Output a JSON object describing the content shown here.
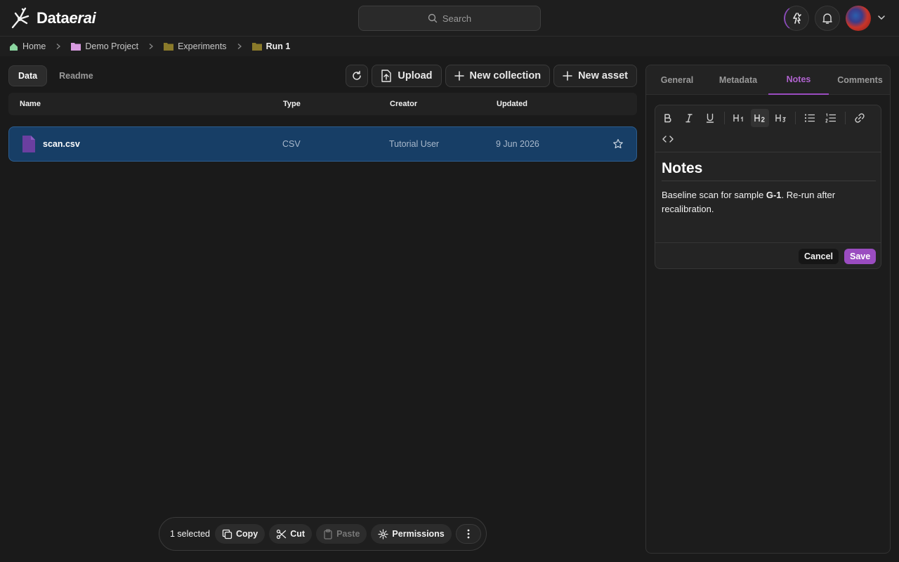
{
  "app": {
    "logo_text_regular": "Data",
    "logo_text_italic": "erai"
  },
  "header": {
    "search_placeholder": "Search"
  },
  "breadcrumb": [
    {
      "label": "Home",
      "icon": "home-icon",
      "color": "#8bd6a0"
    },
    {
      "label": "Demo Project",
      "icon": "folder-icon",
      "color": "#d89be0"
    },
    {
      "label": "Experiments",
      "icon": "folder-icon",
      "color": "#8a7a2a"
    },
    {
      "label": "Run 1",
      "icon": "folder-icon",
      "color": "#8a7a2a"
    }
  ],
  "left_tabs": [
    {
      "label": "Data",
      "active": true
    },
    {
      "label": "Readme",
      "active": false
    }
  ],
  "toolbar": {
    "refresh_icon": "refresh-icon",
    "upload_label": "Upload",
    "new_collection_label": "New collection",
    "new_asset_label": "New asset"
  },
  "table": {
    "columns": [
      "Name",
      "Type",
      "Creator",
      "Updated"
    ],
    "rows": [
      {
        "name": "scan.csv",
        "type": "CSV",
        "creator": "Tutorial User",
        "updated": "9 Jun 2026",
        "selected": true,
        "starred": false
      }
    ]
  },
  "selection_bar": {
    "count_label": "1 selected",
    "copy_label": "Copy",
    "cut_label": "Cut",
    "paste_label": "Paste",
    "permissions_label": "Permissions"
  },
  "right_panel": {
    "tabs": [
      {
        "label": "General",
        "active": false
      },
      {
        "label": "Metadata",
        "active": false
      },
      {
        "label": "Notes",
        "active": true
      },
      {
        "label": "Comments",
        "active": false
      }
    ],
    "editor": {
      "tools": [
        "bold-icon",
        "italic-icon",
        "underline-icon",
        "h1-icon",
        "h2-icon",
        "h3-icon",
        "bullet-list-icon",
        "numbered-list-icon",
        "link-icon",
        "code-icon"
      ],
      "active_tool": "h2-icon",
      "heading": "Notes",
      "body_before": "Baseline scan for sample ",
      "body_bold": "G-1",
      "body_after": ". Re-run after recalibration.",
      "cancel_label": "Cancel",
      "save_label": "Save"
    }
  },
  "colors": {
    "accent": "#9a4cc0",
    "selected_row": "#173e66",
    "file_icon": "#6b3fa0"
  }
}
